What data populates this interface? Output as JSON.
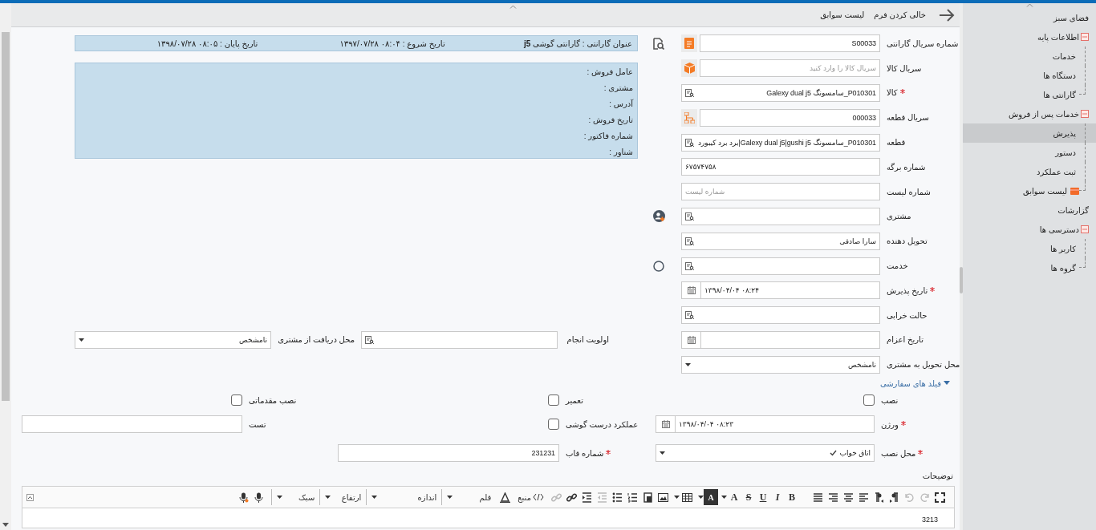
{
  "top_bar": {
    "actions": [
      {
        "label": "خالی کردن فرم"
      },
      {
        "label": "لیست سوابق"
      }
    ]
  },
  "warranty_info": {
    "title": "عنوان گارانتی : گارانتی گوشی **j5**",
    "start": "تاریخ شروع : ۰۸:۰۴ ۱۳۹۷/۰۷/۲۸",
    "end": "تاریخ پایان : ۰۸:۰۵ ۱۳۹۸/۰۷/۲۸",
    "details": [
      "عامل فروش :",
      "مشتری :",
      "آدرس :",
      "تاریخ فروش :",
      "شماره فاکتور :",
      "شناور :"
    ]
  },
  "fields": [
    {
      "kind": "addon",
      "label": "شماره سریال گارانتی",
      "required": false,
      "value": "S00033"
    },
    {
      "kind": "addon",
      "label": "سریال کالا",
      "required": false,
      "placeholder": "سریال کالا را وارد کنید"
    },
    {
      "kind": "lookup",
      "label": "کالا",
      "required": true,
      "value": "P010301_سامسونگ Galexy dual j5"
    },
    {
      "kind": "addon",
      "label": "سریال قطعه",
      "required": false,
      "value": "000033"
    },
    {
      "kind": "lookup",
      "label": "قطعه",
      "required": false,
      "value": "P010301_سامسونگ Galexy dual j5|gushi j5|برد برد کیبورد"
    },
    {
      "kind": "text",
      "label": "شماره برگه",
      "required": false,
      "value": "۶۷۵۷۴۷۵۸"
    },
    {
      "kind": "text",
      "label": "شماره لیست",
      "required": false,
      "placeholder": "شماره لیست"
    },
    {
      "kind": "lookup",
      "label": "مشتری",
      "required": false
    },
    {
      "kind": "lookup",
      "label": "تحویل دهنده",
      "required": false,
      "value": "سارا صادقی"
    },
    {
      "kind": "lookup",
      "label": "خدمت",
      "required": false
    },
    {
      "kind": "date",
      "label": "تاریخ پذیرش",
      "required": true,
      "value": "۰۸:۲۴ ۱۳۹۸/۰۴/۰۴"
    },
    {
      "kind": "lookup",
      "label": "حالت خرابی",
      "required": false
    },
    {
      "kind": "date",
      "label": "تاریخ اعزام",
      "required": false
    },
    {
      "kind": "select",
      "label": "محل تحویل به مشتری",
      "required": false,
      "value": "نامشخص"
    }
  ],
  "left_fields": [
    {
      "kind": "lookup",
      "label": "اولویت انجام"
    },
    {
      "kind": "select",
      "label": "محل دریافت از مشتری",
      "value": "نامشخص"
    }
  ],
  "custom_fields": {
    "title": "فیلد های سفارشی",
    "expanded": true,
    "rows": [
      [
        {
          "kind": "checkbox",
          "label": "نصب",
          "checked": false
        },
        {
          "kind": "checkbox",
          "label": "تعمیر",
          "checked": false
        },
        {
          "kind": "checkbox",
          "label": "نصب مقدماتی",
          "checked": false
        }
      ],
      [
        {
          "kind": "date",
          "label": "ورژن",
          "required": true,
          "value": "۰۸:۲۳ ۱۳۹۸/۰۴/۰۴"
        },
        {
          "kind": "checkbox",
          "label": "عملکرد درست گوشی",
          "checked": false
        },
        {
          "kind": "text",
          "label": "تست",
          "required": false
        }
      ],
      [
        {
          "kind": "select",
          "label": "محل نصب",
          "required": true,
          "value": "اتاق خواب",
          "ticked": true
        },
        {
          "kind": "text",
          "label": "شماره قاب",
          "required": true,
          "value": "231231"
        }
      ]
    ]
  },
  "editor": {
    "label": "توضیحات",
    "format_buttons": [
      "B",
      "I",
      "U",
      "S",
      "A",
      "A"
    ],
    "source_button": "منبع",
    "dropdowns": [
      "قلم",
      "اندازه",
      "ارتفاع",
      "سبک"
    ],
    "content": "3213"
  },
  "sidebar": {
    "items": [
      {
        "kind": "link",
        "label": "فضای سبز",
        "selected": false
      },
      {
        "kind": "group",
        "label": "اطلاعات پایه",
        "expanded": true,
        "selected": false,
        "children": [
          {
            "kind": "link",
            "label": "خدمات",
            "selected": false
          },
          {
            "kind": "link",
            "label": "دستگاه ها",
            "selected": false
          },
          {
            "kind": "link",
            "label": "گارانتی ها",
            "selected": false
          }
        ]
      },
      {
        "kind": "group",
        "label": "خدمات پس از فروش",
        "expanded": true,
        "selected": false,
        "children": [
          {
            "kind": "link",
            "label": "پذیرش",
            "selected": true
          },
          {
            "kind": "link",
            "label": "دستور",
            "selected": false
          },
          {
            "kind": "link",
            "label": "ثبت عملکرد",
            "selected": false
          },
          {
            "kind": "icon-link",
            "label": "لیست سوابق",
            "selected": false
          }
        ]
      },
      {
        "kind": "link",
        "label": "گزارشات",
        "selected": false
      },
      {
        "kind": "group",
        "label": "دسترسی ها",
        "expanded": true,
        "selected": false,
        "children": [
          {
            "kind": "link",
            "label": "کاربر ها",
            "selected": false
          },
          {
            "kind": "link",
            "label": "گروه ها",
            "selected": false
          }
        ]
      }
    ]
  }
}
